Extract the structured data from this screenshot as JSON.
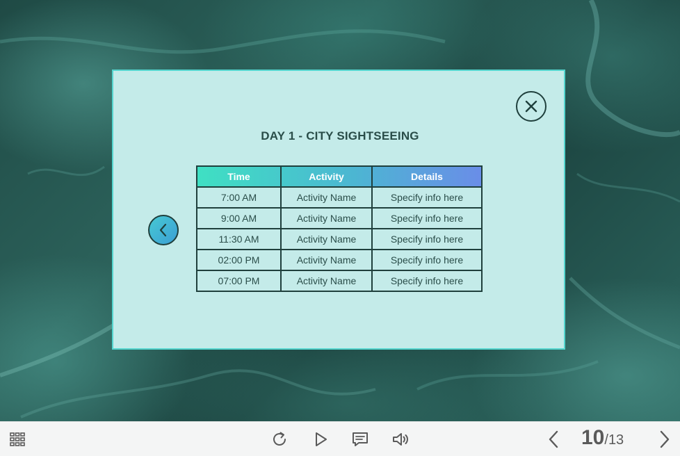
{
  "modal": {
    "title": "DAY 1 - CITY SIGHTSEEING",
    "table": {
      "headers": [
        "Time",
        "Activity",
        "Details"
      ],
      "rows": [
        [
          "7:00 AM",
          "Activity Name",
          "Specify info here"
        ],
        [
          "9:00 AM",
          "Activity Name",
          "Specify info here"
        ],
        [
          "11:30 AM",
          "Activity Name",
          "Specify info here"
        ],
        [
          "02:00 PM",
          "Activity Name",
          "Specify info here"
        ],
        [
          "07:00 PM",
          "Activity Name",
          "Specify info here"
        ]
      ]
    },
    "close_icon": "close-icon",
    "back_icon": "chevron-left-icon"
  },
  "toolbar": {
    "icons": [
      "menu-grid-icon",
      "replay-icon",
      "play-icon",
      "comment-icon",
      "volume-icon",
      "prev-icon",
      "next-icon"
    ],
    "page_current": "10",
    "page_separator": "/",
    "page_total": "13"
  },
  "colors": {
    "modal_bg": "#c4ebe9",
    "modal_border": "#55d6cf",
    "header_gradient_start": "#3fe0c3",
    "header_gradient_end": "#6a8de8",
    "dark_text": "#2a4d49"
  }
}
